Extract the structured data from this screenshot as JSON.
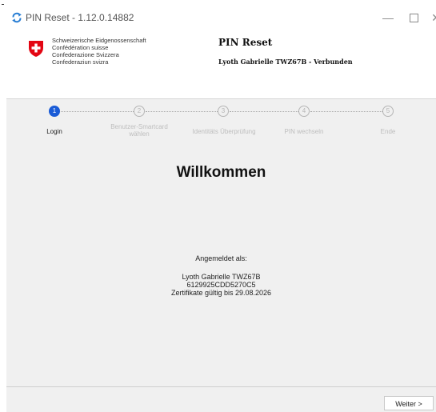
{
  "window": {
    "title": "PIN Reset - 1.12.0.14882",
    "minimize_glyph": "—",
    "close_glyph": "✕",
    "icon": "refresh-arrows-icon"
  },
  "header": {
    "confederation_lines": [
      "Schweizerische Eidgenossenschaft",
      "Confédération suisse",
      "Confederazione Svizzera",
      "Confederaziun svizra"
    ],
    "product_title": "PIN Reset",
    "connection_status": "Lyoth Gabrielle TWZ67B - Verbunden",
    "crest_icon": "swiss-cross-icon",
    "crest_color": "#e30613"
  },
  "steps": [
    {
      "number": "1",
      "label": "Login",
      "active": true
    },
    {
      "number": "2",
      "label": "Benutzer-Smartcard\nwählen",
      "active": false
    },
    {
      "number": "3",
      "label": "Identitäts Überprüfung",
      "active": false
    },
    {
      "number": "4",
      "label": "PIN wechseln",
      "active": false
    },
    {
      "number": "5",
      "label": "Ende",
      "active": false
    }
  ],
  "main": {
    "heading": "Willkommen",
    "logged_in_label": "Angemeldet als:",
    "user_name": "Lyoth Gabrielle TWZ67B",
    "card_id": "6129925CDD5270C5",
    "cert_validity": "Zertifikate gültig bis 29.08.2026"
  },
  "footer": {
    "next_label": "Weiter >"
  },
  "colors": {
    "accent": "#1a5bd6",
    "step_inactive": "#b5b5b5",
    "background": "#f0f0f0"
  }
}
